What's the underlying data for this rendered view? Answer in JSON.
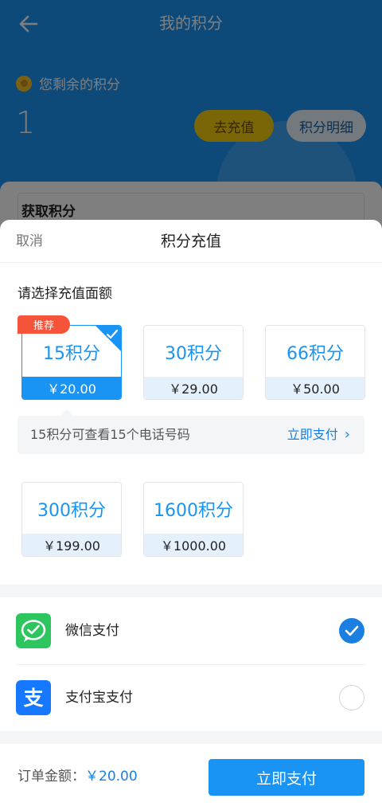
{
  "header": {
    "title": "我的积分",
    "remaining_label": "您剩余的积分",
    "points": "1",
    "recharge_button": "去充值",
    "detail_button": "积分明细"
  },
  "background_section": {
    "title": "获取积分"
  },
  "sheet": {
    "cancel": "取消",
    "title": "积分充值",
    "section_label": "请选择充值面额",
    "badge": "推荐",
    "options": [
      {
        "amount": "15积分",
        "price": "￥20.00",
        "selected": true
      },
      {
        "amount": "30积分",
        "price": "￥29.00",
        "selected": false
      },
      {
        "amount": "66积分",
        "price": "￥50.00",
        "selected": false
      },
      {
        "amount": "300积分",
        "price": "￥199.00",
        "selected": false
      },
      {
        "amount": "1600积分",
        "price": "￥1000.00",
        "selected": false
      }
    ],
    "info_text": "15积分可查看15个电话号码",
    "info_link": "立即支付",
    "payment_methods": [
      {
        "name": "微信支付",
        "icon": "wechat-pay-icon",
        "selected": true
      },
      {
        "name": "支付宝支付",
        "icon": "alipay-icon",
        "selected": false
      }
    ],
    "footer": {
      "amount_label": "订单金额：",
      "amount_value": "￥20.00",
      "pay_button": "立即支付"
    }
  },
  "colors": {
    "primary": "#1a94f4",
    "header_bg": "#1a94f4",
    "recharge_button": "#f5cd0f",
    "badge": "#f5543b",
    "wechat": "#2dc55e",
    "alipay": "#1677ff"
  }
}
